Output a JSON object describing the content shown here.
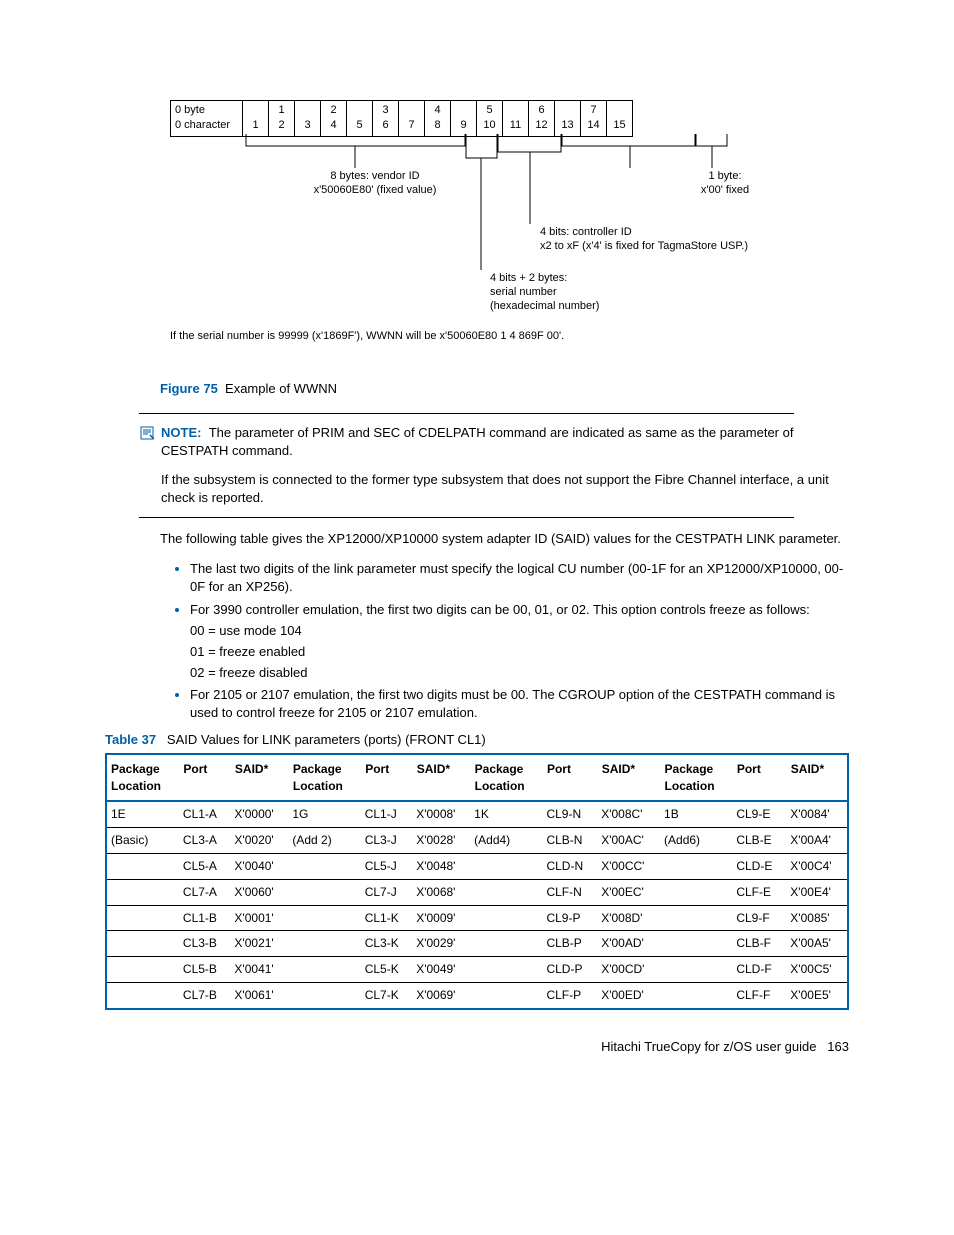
{
  "diagram": {
    "header_row1": [
      "0 byte",
      "",
      "1",
      "",
      "2",
      "",
      "3",
      "",
      "4",
      "",
      "5",
      "",
      "6",
      "",
      "7",
      ""
    ],
    "header_row2": [
      "0 character",
      "1",
      "2",
      "3",
      "4",
      "5",
      "6",
      "7",
      "8",
      "9",
      "10",
      "11",
      "12",
      "13",
      "14",
      "15"
    ],
    "vendor": "8 bytes: vendor ID\nx'50060E80' (fixed value)",
    "onebyte": "1 byte:\nx'00' fixed",
    "controller": "4 bits: controller ID\nx2 to xF (x'4' is fixed for TagmaStore USP.)",
    "serial": "4 bits + 2 bytes:\nserial number\n(hexadecimal number)",
    "example": "If the serial number is 99999 (x'1869F'), WWNN will be x'50060E80 1 4 869F 00'."
  },
  "figure": {
    "label": "Figure 75",
    "text": "Example of WWNN"
  },
  "note": {
    "label": "NOTE:",
    "line1": "The parameter of PRIM and SEC of CDELPATH command are indicated as same as the parameter of CESTPATH command.",
    "line2": "If the subsystem is connected to the former type subsystem that does not support the Fibre Channel interface, a unit check is reported."
  },
  "intro": "The following table gives the XP12000/XP10000 system adapter ID (SAID) values for the CESTPATH LINK parameter.",
  "bullets": {
    "b1": "The last two digits of the link parameter must specify the logical CU number (00-1F for an XP12000/XP10000, 00-0F for an XP256).",
    "b2": "For 3990 controller emulation, the first two digits can be 00, 01, or 02. This option controls freeze as follows:",
    "b2a": "00 = use mode 104",
    "b2b": "01 = freeze enabled",
    "b2c": "02 = freeze disabled",
    "b3": "For 2105 or 2107 emulation, the first two digits must be 00. The CGROUP option of the CESTPATH command is used to control freeze for 2105 or 2107 emulation."
  },
  "table_caption": {
    "label": "Table 37",
    "text": "SAID Values for  LINK parameters (ports) (FRONT CL1)"
  },
  "table_headers": [
    "Package Location",
    "Port",
    "SAID*",
    "Package Location",
    "Port",
    "SAID*",
    "Package Location",
    "Port",
    "SAID*",
    "Package Location",
    "Port",
    "SAID*"
  ],
  "chart_data": {
    "type": "table",
    "columns": [
      "Package Location",
      "Port",
      "SAID*",
      "Package Location",
      "Port",
      "SAID*",
      "Package Location",
      "Port",
      "SAID*",
      "Package Location",
      "Port",
      "SAID*"
    ],
    "rows": [
      [
        "1E",
        "CL1-A",
        "X'0000'",
        "1G",
        "CL1-J",
        "X'0008'",
        "1K",
        "CL9-N",
        "X'008C'",
        "1B",
        "CL9-E",
        "X'0084'"
      ],
      [
        "(Basic)",
        "CL3-A",
        "X'0020'",
        "(Add 2)",
        "CL3-J",
        "X'0028'",
        "(Add4)",
        "CLB-N",
        "X'00AC'",
        "(Add6)",
        "CLB-E",
        "X'00A4'"
      ],
      [
        "",
        "CL5-A",
        "X'0040'",
        "",
        "CL5-J",
        "X'0048'",
        "",
        "CLD-N",
        "X'00CC'",
        "",
        "CLD-E",
        "X'00C4'"
      ],
      [
        "",
        "CL7-A",
        "X'0060'",
        "",
        "CL7-J",
        "X'0068'",
        "",
        "CLF-N",
        "X'00EC'",
        "",
        "CLF-E",
        "X'00E4'"
      ],
      [
        "",
        "CL1-B",
        "X'0001'",
        "",
        "CL1-K",
        "X'0009'",
        "",
        "CL9-P",
        "X'008D'",
        "",
        "CL9-F",
        "X'0085'"
      ],
      [
        "",
        "CL3-B",
        "X'0021'",
        "",
        "CL3-K",
        "X'0029'",
        "",
        "CLB-P",
        "X'00AD'",
        "",
        "CLB-F",
        "X'00A5'"
      ],
      [
        "",
        "CL5-B",
        "X'0041'",
        "",
        "CL5-K",
        "X'0049'",
        "",
        "CLD-P",
        "X'00CD'",
        "",
        "CLD-F",
        "X'00C5'"
      ],
      [
        "",
        "CL7-B",
        "X'0061'",
        "",
        "CL7-K",
        "X'0069'",
        "",
        "CLF-P",
        "X'00ED'",
        "",
        "CLF-F",
        "X'00E5'"
      ]
    ]
  },
  "footer": {
    "title": "Hitachi TrueCopy for z/OS user guide",
    "page": "163"
  }
}
